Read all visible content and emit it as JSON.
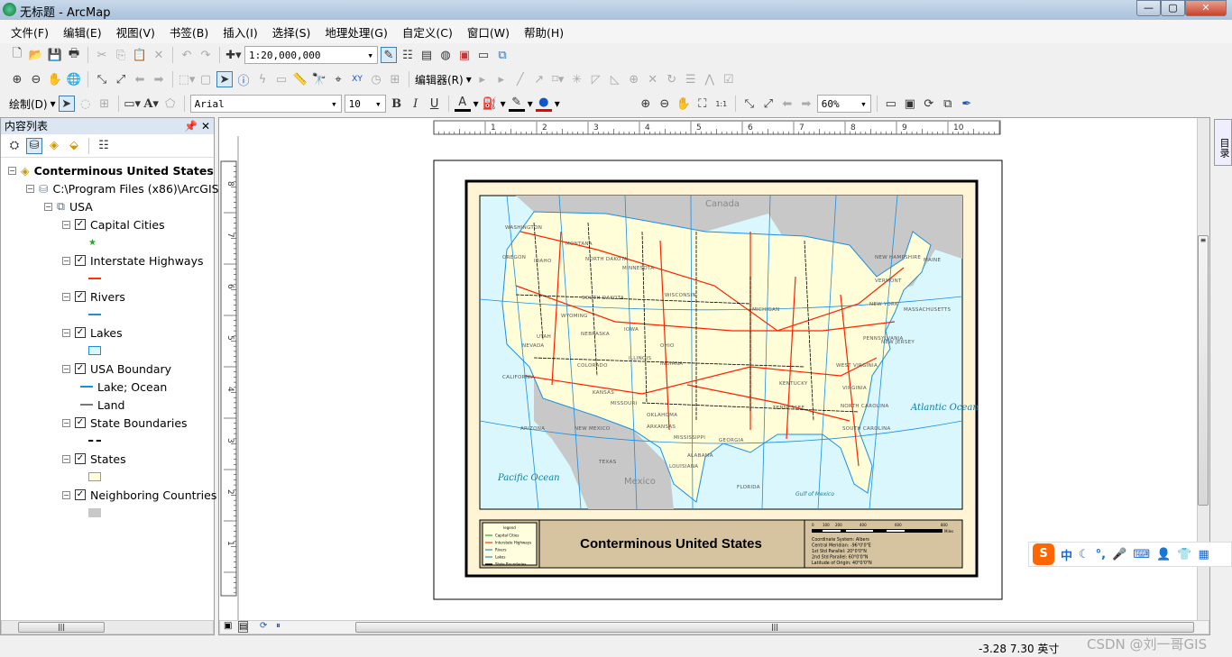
{
  "window": {
    "title": "无标题 - ArcMap",
    "min": "—",
    "max": "▢",
    "close": "✕"
  },
  "menu": [
    "文件(F)",
    "编辑(E)",
    "视图(V)",
    "书签(B)",
    "插入(I)",
    "选择(S)",
    "地理处理(G)",
    "自定义(C)",
    "窗口(W)",
    "帮助(H)"
  ],
  "toolbar": {
    "scale": "1:20,000,000",
    "editor": "编辑器(R)",
    "draw": "绘制(D)",
    "font": "Arial",
    "font_size": "10",
    "bold": "B",
    "italic": "I",
    "underline": "U",
    "zoom_percent": "60%"
  },
  "toc": {
    "title": "内容列表",
    "pin": "ᵖ",
    "close": "✕",
    "items": [
      {
        "label": "Conterminous United States",
        "level": 0,
        "type": "dataframe",
        "bold": true
      },
      {
        "label": "C:\\Program Files (x86)\\ArcGIS",
        "level": 1,
        "type": "database"
      },
      {
        "label": "USA",
        "level": 2,
        "type": "group"
      },
      {
        "label": "Capital Cities",
        "level": 3,
        "type": "layer",
        "checked": true,
        "symbol": "star"
      },
      {
        "label": "Interstate Highways",
        "level": 3,
        "type": "layer",
        "checked": true,
        "symbol": "red-line"
      },
      {
        "label": "Rivers",
        "level": 3,
        "type": "layer",
        "checked": true,
        "symbol": "blue-line"
      },
      {
        "label": "Lakes",
        "level": 3,
        "type": "layer",
        "checked": true,
        "symbol": "blue-box"
      },
      {
        "label": "USA Boundary",
        "level": 3,
        "type": "layer",
        "checked": true
      },
      {
        "label": "Lake; Ocean",
        "level": 4,
        "type": "legend",
        "symbol": "blue-line"
      },
      {
        "label": "Land",
        "level": 4,
        "type": "legend",
        "symbol": "gray-line"
      },
      {
        "label": "State Boundaries",
        "level": 3,
        "type": "layer",
        "checked": true,
        "symbol": "dash-line"
      },
      {
        "label": "States",
        "level": 3,
        "type": "layer",
        "checked": true,
        "symbol": "cream-box"
      },
      {
        "label": "Neighboring Countries",
        "level": 3,
        "type": "layer",
        "checked": true,
        "symbol": "gray-box"
      }
    ]
  },
  "ruler": {
    "top": [
      "1",
      "2",
      "3",
      "4",
      "5",
      "6",
      "7",
      "8",
      "9",
      "10"
    ],
    "left": [
      "8",
      "7",
      "6",
      "5",
      "4",
      "3",
      "2",
      "1"
    ]
  },
  "map": {
    "title": "Conterminous United States",
    "labels": {
      "canada": "Canada",
      "mexico": "Mexico",
      "pacific": "Pacific Ocean",
      "atlantic": "Atlantic Ocean",
      "gulf": "Gulf of Mexico"
    },
    "states": [
      "WASHINGTON",
      "OREGON",
      "IDAHO",
      "MONTANA",
      "NORTH DAKOTA",
      "MINNESOTA",
      "SOUTH DAKOTA",
      "WYOMING",
      "NEVADA",
      "UTAH",
      "CALIFORNIA",
      "COLORADO",
      "NEBRASKA",
      "IOWA",
      "WISCONSIN",
      "MICHIGAN",
      "KANSAS",
      "MISSOURI",
      "ILLINOIS",
      "INDIANA",
      "OHIO",
      "ARIZONA",
      "NEW MEXICO",
      "OKLAHOMA",
      "ARKANSAS",
      "TEXAS",
      "LOUISIANA",
      "MISSISSIPPI",
      "ALABAMA",
      "GEORGIA",
      "FLORIDA",
      "TENNESSEE",
      "KENTUCKY",
      "WEST VIRGINIA",
      "VIRGINIA",
      "NORTH CAROLINA",
      "SOUTH CAROLINA",
      "PENNSYLVANIA",
      "NEW YORK",
      "NEW JERSEY",
      "MASSACHUSETTS",
      "NEW HAMPSHIRE",
      "VERMONT",
      "MAINE"
    ],
    "legend": {
      "title": "legend",
      "items": [
        "Capital Cities",
        "Interstate Highways",
        "Rivers",
        "Lakes",
        "State Boundaries"
      ]
    },
    "scalebar": {
      "ticks": [
        "0",
        "100",
        "200",
        "400",
        "600",
        "800"
      ],
      "unit": "Miles"
    },
    "projection": [
      "Coordinate System: Albers",
      "Central Meridian: -96°0'0\"E",
      "1st Std Parallel: 20°0'0\"N",
      "2nd Std Parallel: 60°0'0\"N",
      "Latitude of Origin: 40°0'0\"N"
    ],
    "colors": {
      "ocean": "#d9f7fd",
      "land": "#fffed9",
      "neighbors": "#c8c8c8",
      "highways": "#ff2200",
      "rivers": "#1a8fe0",
      "frame_bg": "#fff5d6",
      "title_bg": "#d6c4a0"
    }
  },
  "status": {
    "coords": "-3.28  7.30 英寸",
    "watermark": "CSDN @刘一哥GIS"
  },
  "dock": {
    "catalog": "目录"
  },
  "ime": {
    "label": "中"
  }
}
